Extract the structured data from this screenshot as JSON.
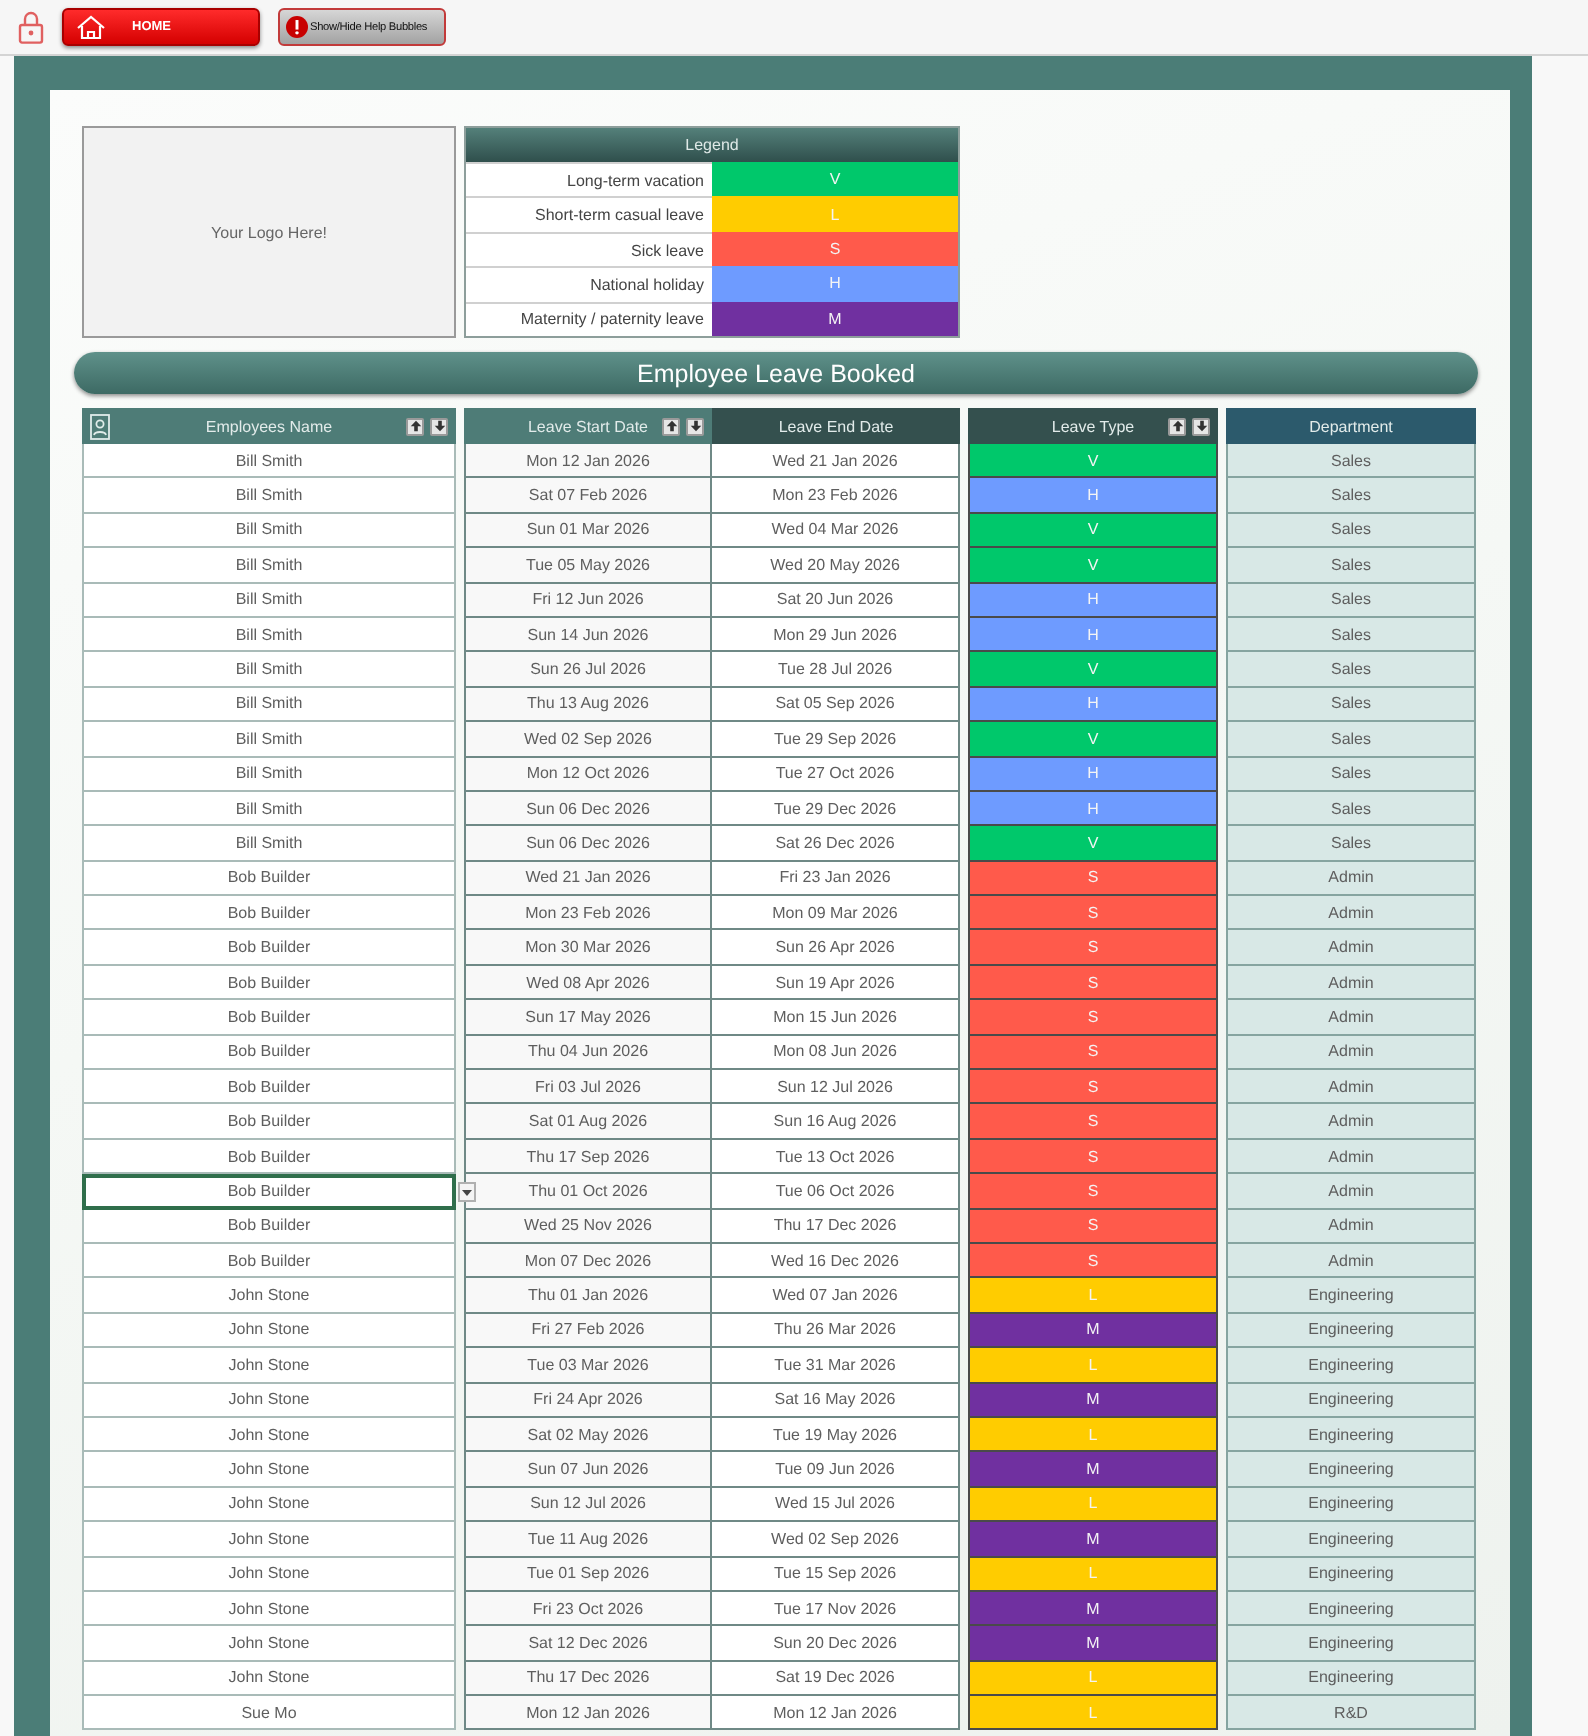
{
  "toolbar": {
    "home_button": "HOME",
    "help_button": "Show/Hide Help Bubbles"
  },
  "logo_box": {
    "text": "Your Logo Here!"
  },
  "legend": {
    "title": "Legend",
    "items": [
      {
        "label": "Long-term vacation",
        "code": "V",
        "color": "#00c86b"
      },
      {
        "label": "Short-term casual leave",
        "code": "L",
        "color": "#ffcc00"
      },
      {
        "label": "Sick leave",
        "code": "S",
        "color": "#ff5a4b"
      },
      {
        "label": "National holiday",
        "code": "H",
        "color": "#6e9bff"
      },
      {
        "label": "Maternity / paternity leave",
        "code": "M",
        "color": "#7030a0"
      }
    ]
  },
  "section_title": "Employee Leave Booked",
  "table": {
    "columns": [
      {
        "label": "Employees Name",
        "sortable": true
      },
      {
        "label": "Leave Start Date",
        "sortable": true
      },
      {
        "label": "Leave End Date",
        "sortable": false
      },
      {
        "label": "Leave Type",
        "sortable": true
      },
      {
        "label": "Department",
        "sortable": false
      }
    ],
    "rows": [
      {
        "name": "Bill Smith",
        "start": "Mon 12 Jan 2026",
        "end": "Wed 21 Jan 2026",
        "leave_type": "V",
        "color": "#00c86b",
        "department": "Sales",
        "selected": false
      },
      {
        "name": "Bill Smith",
        "start": "Sat 07 Feb 2026",
        "end": "Mon 23 Feb 2026",
        "leave_type": "H",
        "color": "#6e9bff",
        "department": "Sales",
        "selected": false
      },
      {
        "name": "Bill Smith",
        "start": "Sun 01 Mar 2026",
        "end": "Wed 04 Mar 2026",
        "leave_type": "V",
        "color": "#00c86b",
        "department": "Sales",
        "selected": false
      },
      {
        "name": "Bill Smith",
        "start": "Tue 05 May 2026",
        "end": "Wed 20 May 2026",
        "leave_type": "V",
        "color": "#00c86b",
        "department": "Sales",
        "selected": false
      },
      {
        "name": "Bill Smith",
        "start": "Fri 12 Jun 2026",
        "end": "Sat 20 Jun 2026",
        "leave_type": "H",
        "color": "#6e9bff",
        "department": "Sales",
        "selected": false
      },
      {
        "name": "Bill Smith",
        "start": "Sun 14 Jun 2026",
        "end": "Mon 29 Jun 2026",
        "leave_type": "H",
        "color": "#6e9bff",
        "department": "Sales",
        "selected": false
      },
      {
        "name": "Bill Smith",
        "start": "Sun 26 Jul 2026",
        "end": "Tue 28 Jul 2026",
        "leave_type": "V",
        "color": "#00c86b",
        "department": "Sales",
        "selected": false
      },
      {
        "name": "Bill Smith",
        "start": "Thu 13 Aug 2026",
        "end": "Sat 05 Sep 2026",
        "leave_type": "H",
        "color": "#6e9bff",
        "department": "Sales",
        "selected": false
      },
      {
        "name": "Bill Smith",
        "start": "Wed 02 Sep 2026",
        "end": "Tue 29 Sep 2026",
        "leave_type": "V",
        "color": "#00c86b",
        "department": "Sales",
        "selected": false
      },
      {
        "name": "Bill Smith",
        "start": "Mon 12 Oct 2026",
        "end": "Tue 27 Oct 2026",
        "leave_type": "H",
        "color": "#6e9bff",
        "department": "Sales",
        "selected": false
      },
      {
        "name": "Bill Smith",
        "start": "Sun 06 Dec 2026",
        "end": "Tue 29 Dec 2026",
        "leave_type": "H",
        "color": "#6e9bff",
        "department": "Sales",
        "selected": false
      },
      {
        "name": "Bill Smith",
        "start": "Sun 06 Dec 2026",
        "end": "Sat 26 Dec 2026",
        "leave_type": "V",
        "color": "#00c86b",
        "department": "Sales",
        "selected": false
      },
      {
        "name": "Bob Builder",
        "start": "Wed 21 Jan 2026",
        "end": "Fri 23 Jan 2026",
        "leave_type": "S",
        "color": "#ff5a4b",
        "department": "Admin",
        "selected": false
      },
      {
        "name": "Bob Builder",
        "start": "Mon 23 Feb 2026",
        "end": "Mon 09 Mar 2026",
        "leave_type": "S",
        "color": "#ff5a4b",
        "department": "Admin",
        "selected": false
      },
      {
        "name": "Bob Builder",
        "start": "Mon 30 Mar 2026",
        "end": "Sun 26 Apr 2026",
        "leave_type": "S",
        "color": "#ff5a4b",
        "department": "Admin",
        "selected": false
      },
      {
        "name": "Bob Builder",
        "start": "Wed 08 Apr 2026",
        "end": "Sun 19 Apr 2026",
        "leave_type": "S",
        "color": "#ff5a4b",
        "department": "Admin",
        "selected": false
      },
      {
        "name": "Bob Builder",
        "start": "Sun 17 May 2026",
        "end": "Mon 15 Jun 2026",
        "leave_type": "S",
        "color": "#ff5a4b",
        "department": "Admin",
        "selected": false
      },
      {
        "name": "Bob Builder",
        "start": "Thu 04 Jun 2026",
        "end": "Mon 08 Jun 2026",
        "leave_type": "S",
        "color": "#ff5a4b",
        "department": "Admin",
        "selected": false
      },
      {
        "name": "Bob Builder",
        "start": "Fri 03 Jul 2026",
        "end": "Sun 12 Jul 2026",
        "leave_type": "S",
        "color": "#ff5a4b",
        "department": "Admin",
        "selected": false
      },
      {
        "name": "Bob Builder",
        "start": "Sat 01 Aug 2026",
        "end": "Sun 16 Aug 2026",
        "leave_type": "S",
        "color": "#ff5a4b",
        "department": "Admin",
        "selected": false
      },
      {
        "name": "Bob Builder",
        "start": "Thu 17 Sep 2026",
        "end": "Tue 13 Oct 2026",
        "leave_type": "S",
        "color": "#ff5a4b",
        "department": "Admin",
        "selected": false
      },
      {
        "name": "Bob Builder",
        "start": "Thu 01 Oct 2026",
        "end": "Tue 06 Oct 2026",
        "leave_type": "S",
        "color": "#ff5a4b",
        "department": "Admin",
        "selected": true
      },
      {
        "name": "Bob Builder",
        "start": "Wed 25 Nov 2026",
        "end": "Thu 17 Dec 2026",
        "leave_type": "S",
        "color": "#ff5a4b",
        "department": "Admin",
        "selected": false
      },
      {
        "name": "Bob Builder",
        "start": "Mon 07 Dec 2026",
        "end": "Wed 16 Dec 2026",
        "leave_type": "S",
        "color": "#ff5a4b",
        "department": "Admin",
        "selected": false
      },
      {
        "name": "John Stone",
        "start": "Thu 01 Jan 2026",
        "end": "Wed 07 Jan 2026",
        "leave_type": "L",
        "color": "#ffcc00",
        "department": "Engineering",
        "selected": false
      },
      {
        "name": "John Stone",
        "start": "Fri 27 Feb 2026",
        "end": "Thu 26 Mar 2026",
        "leave_type": "M",
        "color": "#7030a0",
        "department": "Engineering",
        "selected": false
      },
      {
        "name": "John Stone",
        "start": "Tue 03 Mar 2026",
        "end": "Tue 31 Mar 2026",
        "leave_type": "L",
        "color": "#ffcc00",
        "department": "Engineering",
        "selected": false
      },
      {
        "name": "John Stone",
        "start": "Fri 24 Apr 2026",
        "end": "Sat 16 May 2026",
        "leave_type": "M",
        "color": "#7030a0",
        "department": "Engineering",
        "selected": false
      },
      {
        "name": "John Stone",
        "start": "Sat 02 May 2026",
        "end": "Tue 19 May 2026",
        "leave_type": "L",
        "color": "#ffcc00",
        "department": "Engineering",
        "selected": false
      },
      {
        "name": "John Stone",
        "start": "Sun 07 Jun 2026",
        "end": "Tue 09 Jun 2026",
        "leave_type": "M",
        "color": "#7030a0",
        "department": "Engineering",
        "selected": false
      },
      {
        "name": "John Stone",
        "start": "Sun 12 Jul 2026",
        "end": "Wed 15 Jul 2026",
        "leave_type": "L",
        "color": "#ffcc00",
        "department": "Engineering",
        "selected": false
      },
      {
        "name": "John Stone",
        "start": "Tue 11 Aug 2026",
        "end": "Wed 02 Sep 2026",
        "leave_type": "M",
        "color": "#7030a0",
        "department": "Engineering",
        "selected": false
      },
      {
        "name": "John Stone",
        "start": "Tue 01 Sep 2026",
        "end": "Tue 15 Sep 2026",
        "leave_type": "L",
        "color": "#ffcc00",
        "department": "Engineering",
        "selected": false
      },
      {
        "name": "John Stone",
        "start": "Fri 23 Oct 2026",
        "end": "Tue 17 Nov 2026",
        "leave_type": "M",
        "color": "#7030a0",
        "department": "Engineering",
        "selected": false
      },
      {
        "name": "John Stone",
        "start": "Sat 12 Dec 2026",
        "end": "Sun 20 Dec 2026",
        "leave_type": "M",
        "color": "#7030a0",
        "department": "Engineering",
        "selected": false
      },
      {
        "name": "John Stone",
        "start": "Thu 17 Dec 2026",
        "end": "Sat 19 Dec 2026",
        "leave_type": "L",
        "color": "#ffcc00",
        "department": "Engineering",
        "selected": false
      },
      {
        "name": "Sue Mo",
        "start": "Mon 12 Jan 2026",
        "end": "Mon 12 Jan 2026",
        "leave_type": "L",
        "color": "#ffcc00",
        "department": "R&D",
        "selected": false
      }
    ]
  }
}
